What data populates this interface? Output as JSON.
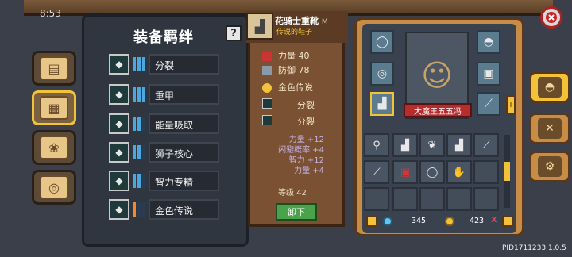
{
  "status": {
    "clock": "8:53"
  },
  "bonds": {
    "title": "装备羁绊",
    "help": "?",
    "items": [
      {
        "label": "分裂",
        "icon": "split-arrows-icon",
        "bars": [
          1,
          1,
          1
        ],
        "color": "#4aa7e0"
      },
      {
        "label": "重甲",
        "icon": "heavy-armor-icon",
        "bars": [
          1,
          1,
          1
        ],
        "color": "#4aa7e0"
      },
      {
        "label": "能量吸取",
        "icon": "energy-drain-icon",
        "bars": [
          1,
          1,
          0
        ],
        "color": "#4aa7e0"
      },
      {
        "label": "狮子核心",
        "icon": "lion-core-icon",
        "bars": [
          1,
          1,
          0
        ],
        "color": "#4aa7e0"
      },
      {
        "label": "智力专精",
        "icon": "intellect-book-icon",
        "bars": [
          1,
          1,
          0
        ],
        "color": "#4aa7e0"
      },
      {
        "label": "金色传说",
        "icon": "golden-legend-icon",
        "bars": [
          1,
          0,
          0
        ],
        "color": "#f08a2a"
      }
    ]
  },
  "item": {
    "name": "花骑士重靴",
    "name_tag": "M",
    "subtitle": "传说的鞋子",
    "stats": [
      {
        "label": "力量",
        "value": "40"
      },
      {
        "label": "防御",
        "value": "78"
      }
    ],
    "traits": [
      "金色传说",
      "分裂",
      "分裂"
    ],
    "bonuses": [
      "力量 +12",
      "闪避概率 +4",
      "智力 +12",
      "力量 +4"
    ],
    "level_label": "等级",
    "level": "42",
    "unequip": "卸下"
  },
  "character": {
    "name": "大魔王五五冯",
    "side_tag": "I"
  },
  "currency": {
    "gems": "345",
    "coins": "423",
    "coin_suffix": "X"
  },
  "footer": {
    "pid": "PID1711233 1.0.5"
  }
}
